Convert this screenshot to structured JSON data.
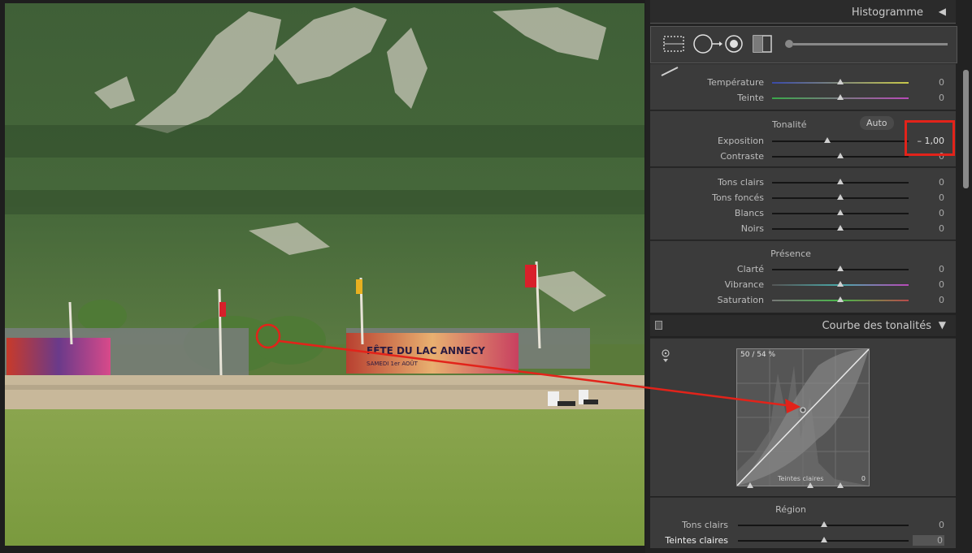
{
  "panel": {
    "histogram_title": "Histogramme",
    "collapse_glyph": "◀",
    "expand_glyph": "▼"
  },
  "white_balance": {
    "sliders": [
      {
        "label": "Température",
        "value": "0",
        "position": 0.5
      },
      {
        "label": "Teinte",
        "value": "0",
        "position": 0.5
      }
    ]
  },
  "tone": {
    "title": "Tonalité",
    "auto_label": "Auto",
    "exposure": {
      "label": "Exposition",
      "value": "– 1,00",
      "position": 0.42
    },
    "contrast": {
      "label": "Contraste",
      "value": "0",
      "position": 0.5
    },
    "sliders": [
      {
        "label": "Tons clairs",
        "value": "0",
        "position": 0.5
      },
      {
        "label": "Tons foncés",
        "value": "0",
        "position": 0.5
      },
      {
        "label": "Blancs",
        "value": "0",
        "position": 0.5
      },
      {
        "label": "Noirs",
        "value": "0",
        "position": 0.5
      }
    ]
  },
  "presence": {
    "title": "Présence",
    "sliders": [
      {
        "label": "Clarté",
        "value": "0",
        "position": 0.5
      },
      {
        "label": "Vibrance",
        "value": "0",
        "position": 0.5
      },
      {
        "label": "Saturation",
        "value": "0",
        "position": 0.5
      }
    ]
  },
  "tone_curve": {
    "title": "Courbe des tonalités",
    "readout": "50 / 54 %",
    "region_hover_label": "Teintes claires",
    "corner_value": "0",
    "region_title": "Région",
    "region_sliders": [
      {
        "label": "Tons clairs",
        "value": "0",
        "position": 0.5
      },
      {
        "label": "Teintes claires",
        "value": "0",
        "position": 0.5
      }
    ]
  },
  "photo": {
    "banner_text": "FÊTE DU LAC ANNECY",
    "banner_subtext": "SAMEDI 1er AOÛT"
  },
  "colors": {
    "accent_red": "#e2231a",
    "panel_bg": "#3b3b3b"
  }
}
